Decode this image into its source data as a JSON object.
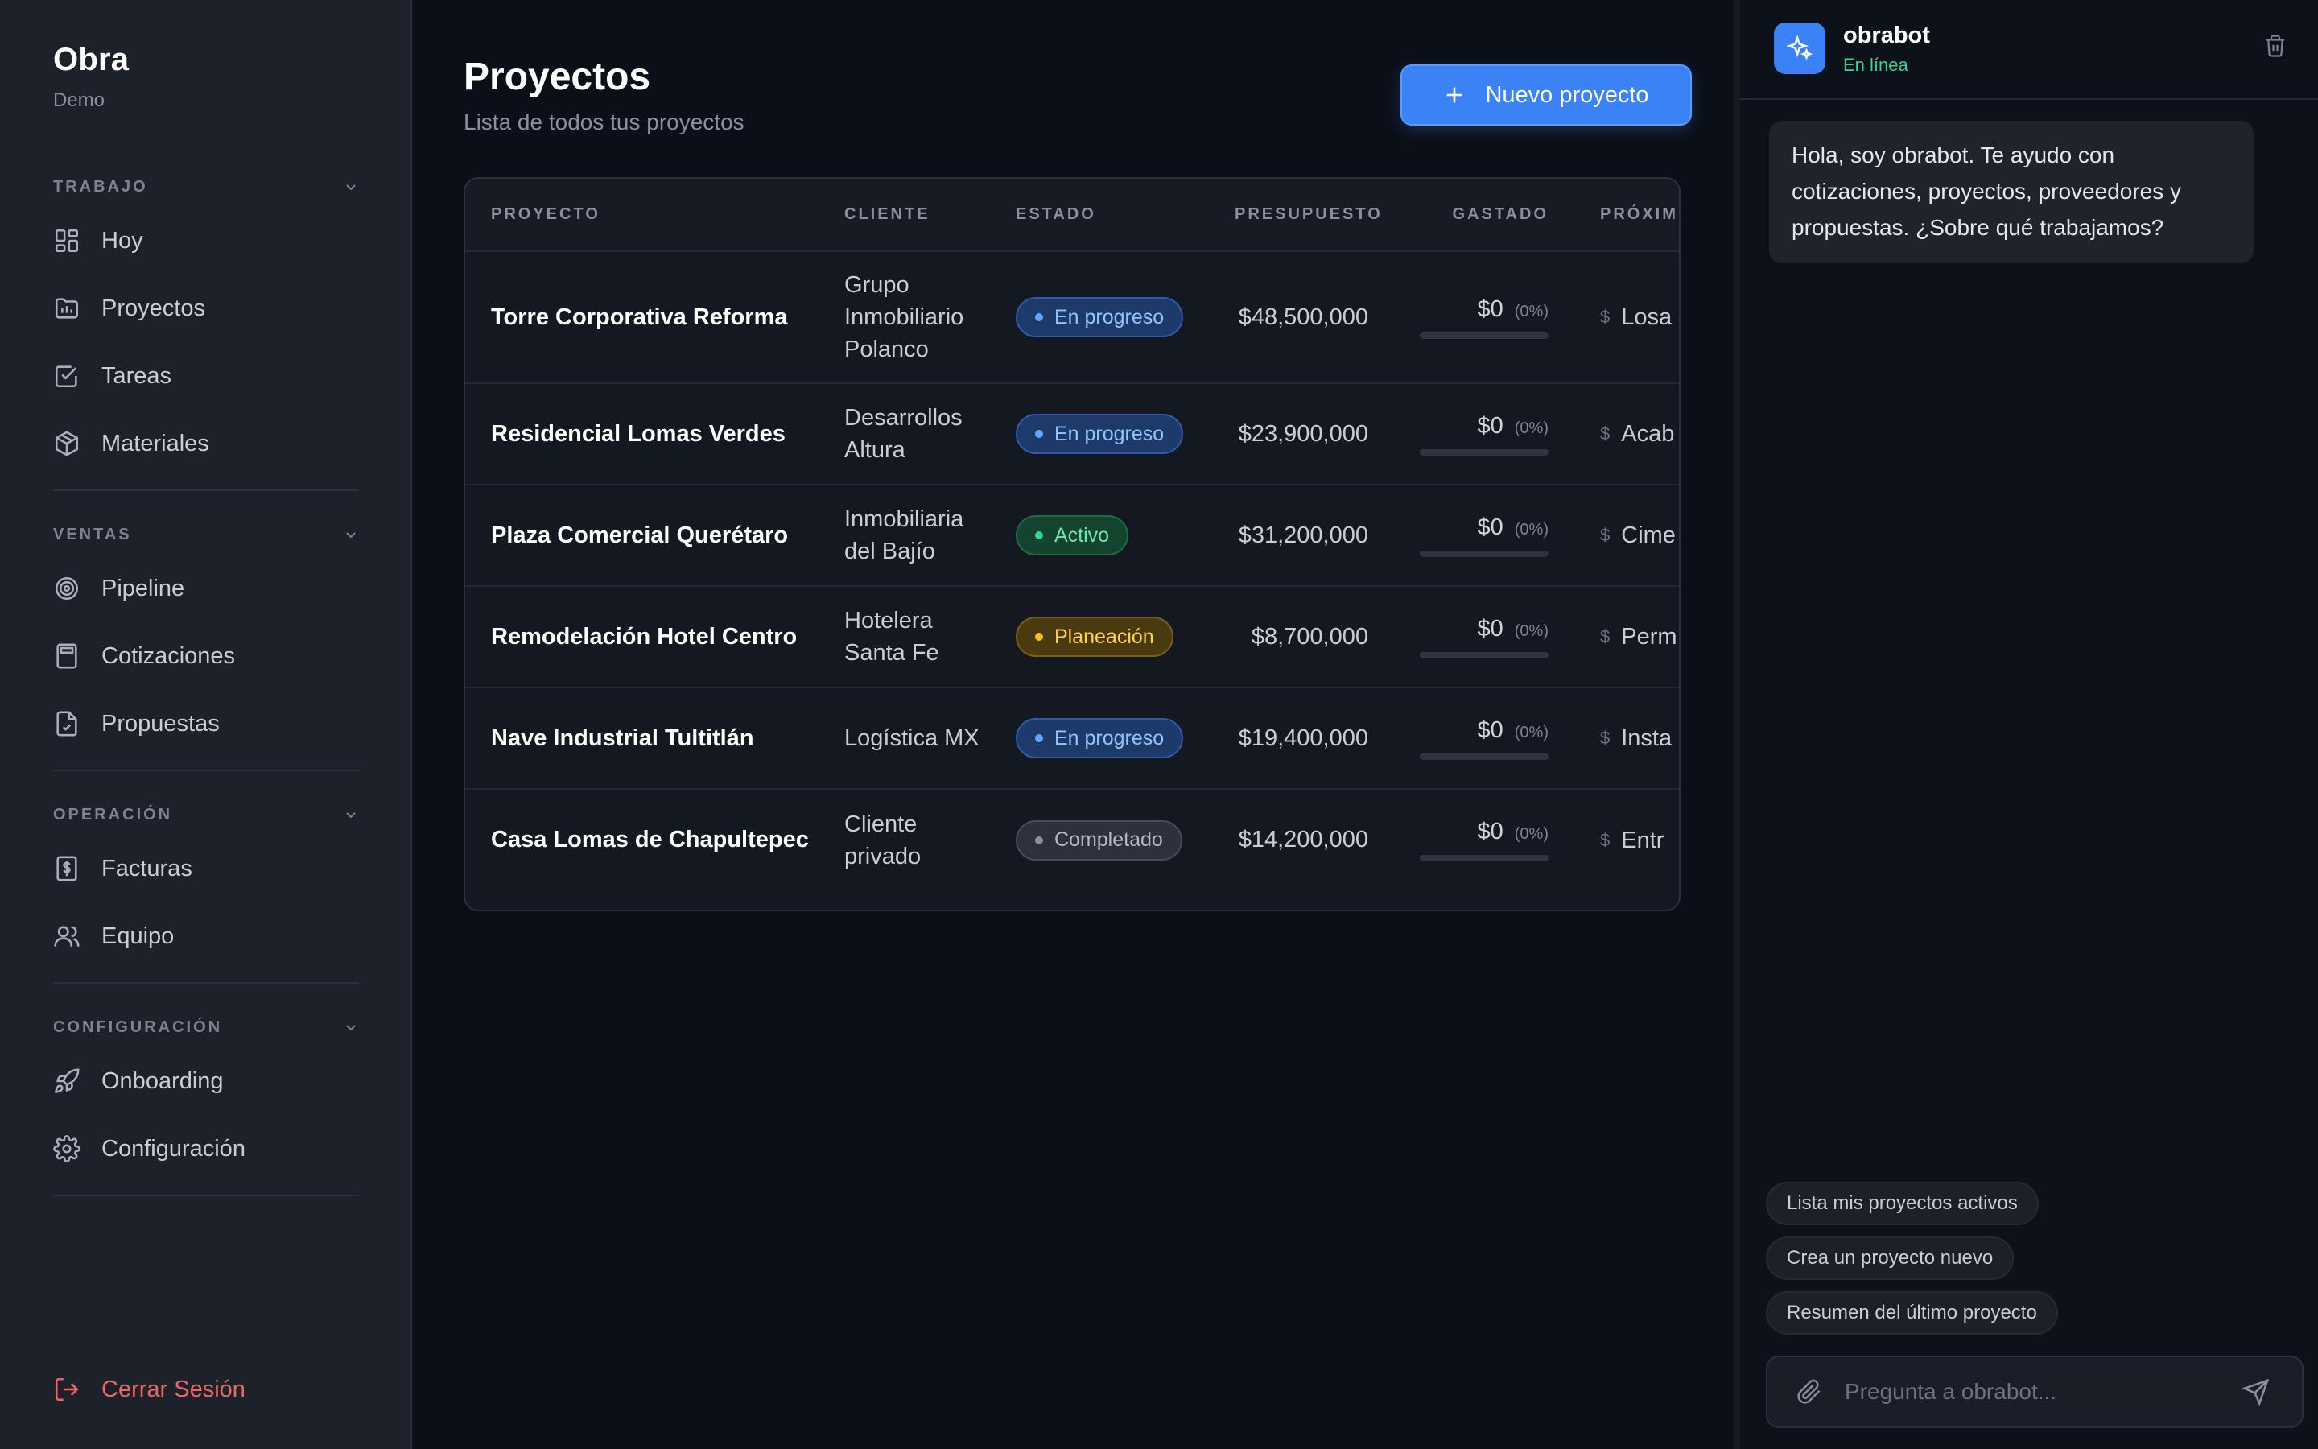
{
  "brand": {
    "title": "Obra",
    "subtitle": "Demo"
  },
  "sidebar": {
    "sections": [
      {
        "label": "TRABAJO",
        "items": [
          {
            "label": "Hoy",
            "icon": "dashboard-icon"
          },
          {
            "label": "Proyectos",
            "icon": "projects-icon"
          },
          {
            "label": "Tareas",
            "icon": "checkbox-icon"
          },
          {
            "label": "Materiales",
            "icon": "box-icon"
          }
        ]
      },
      {
        "label": "VENTAS",
        "items": [
          {
            "label": "Pipeline",
            "icon": "target-icon"
          },
          {
            "label": "Cotizaciones",
            "icon": "calculator-icon"
          },
          {
            "label": "Propuestas",
            "icon": "document-check-icon"
          }
        ]
      },
      {
        "label": "OPERACIÓN",
        "items": [
          {
            "label": "Facturas",
            "icon": "invoice-icon"
          },
          {
            "label": "Equipo",
            "icon": "users-icon"
          }
        ]
      },
      {
        "label": "CONFIGURACIÓN",
        "items": [
          {
            "label": "Onboarding",
            "icon": "rocket-icon"
          },
          {
            "label": "Configuración",
            "icon": "gear-icon"
          }
        ]
      }
    ],
    "logout_label": "Cerrar Sesión"
  },
  "main": {
    "title": "Proyectos",
    "subtitle": "Lista de todos tus proyectos",
    "new_button_label": "Nuevo proyecto",
    "table": {
      "columns": [
        "PROYECTO",
        "CLIENTE",
        "ESTADO",
        "PRESUPUESTO",
        "GASTADO",
        "PRÓXIM"
      ],
      "rows": [
        {
          "project": "Torre Corporativa Reforma",
          "client": "Grupo Inmobiliario Polanco",
          "status": "En progreso",
          "status_type": "progress",
          "budget": "$48,500,000",
          "spent": "$0",
          "spent_pct": "(0%)",
          "spent_fraction": 0,
          "next": "Losa"
        },
        {
          "project": "Residencial Lomas Verdes",
          "client": "Desarrollos Altura",
          "status": "En progreso",
          "status_type": "progress",
          "budget": "$23,900,000",
          "spent": "$0",
          "spent_pct": "(0%)",
          "spent_fraction": 0,
          "next": "Acab torre"
        },
        {
          "project": "Plaza Comercial Querétaro",
          "client": "Inmobiliaria del Bajío",
          "status": "Activo",
          "status_type": "active",
          "budget": "$31,200,000",
          "spent": "$0",
          "spent_pct": "(0%)",
          "spent_fraction": 0,
          "next": "Cime"
        },
        {
          "project": "Remodelación Hotel Centro",
          "client": "Hotelera Santa Fe",
          "status": "Planeación",
          "status_type": "planning",
          "budget": "$8,700,000",
          "spent": "$0",
          "spent_pct": "(0%)",
          "spent_fraction": 0,
          "next": "Perm"
        },
        {
          "project": "Nave Industrial Tultitlán",
          "client": "Logística MX",
          "status": "En progreso",
          "status_type": "progress",
          "budget": "$19,400,000",
          "spent": "$0",
          "spent_pct": "(0%)",
          "spent_fraction": 0,
          "next": "Insta"
        },
        {
          "project": "Casa Lomas de Chapultepec",
          "client": "Cliente privado",
          "status": "Completado",
          "status_type": "done",
          "budget": "$14,200,000",
          "spent": "$0",
          "spent_pct": "(0%)",
          "spent_fraction": 0,
          "next": "Entr"
        }
      ]
    }
  },
  "status_colors": {
    "progress": {
      "bg": "#1e3a6b",
      "border": "#2f5ba8",
      "text": "#93c5fd",
      "dot": "#60a5fa"
    },
    "active": {
      "bg": "#14432e",
      "border": "#1f6b45",
      "text": "#6ee7a8",
      "dot": "#34d399"
    },
    "planning": {
      "bg": "#4a3a10",
      "border": "#7a5f14",
      "text": "#fcd34d",
      "dot": "#fbbf24"
    },
    "done": {
      "bg": "#2c313a",
      "border": "#474d58",
      "text": "#b4bac4",
      "dot": "#8a919e"
    }
  },
  "chat": {
    "bot_name": "obrabot",
    "status": "En línea",
    "greeting": "Hola, soy obrabot. Te ayudo con cotizaciones, proyectos, proveedores y propuestas. ¿Sobre qué trabajamos?",
    "suggestions": [
      "Lista mis proyectos activos",
      "Crea un proyecto nuevo",
      "Resumen del último proyecto"
    ],
    "input_placeholder": "Pregunta a obrabot...",
    "input_value": ""
  },
  "accent_color": "#3b82f6"
}
